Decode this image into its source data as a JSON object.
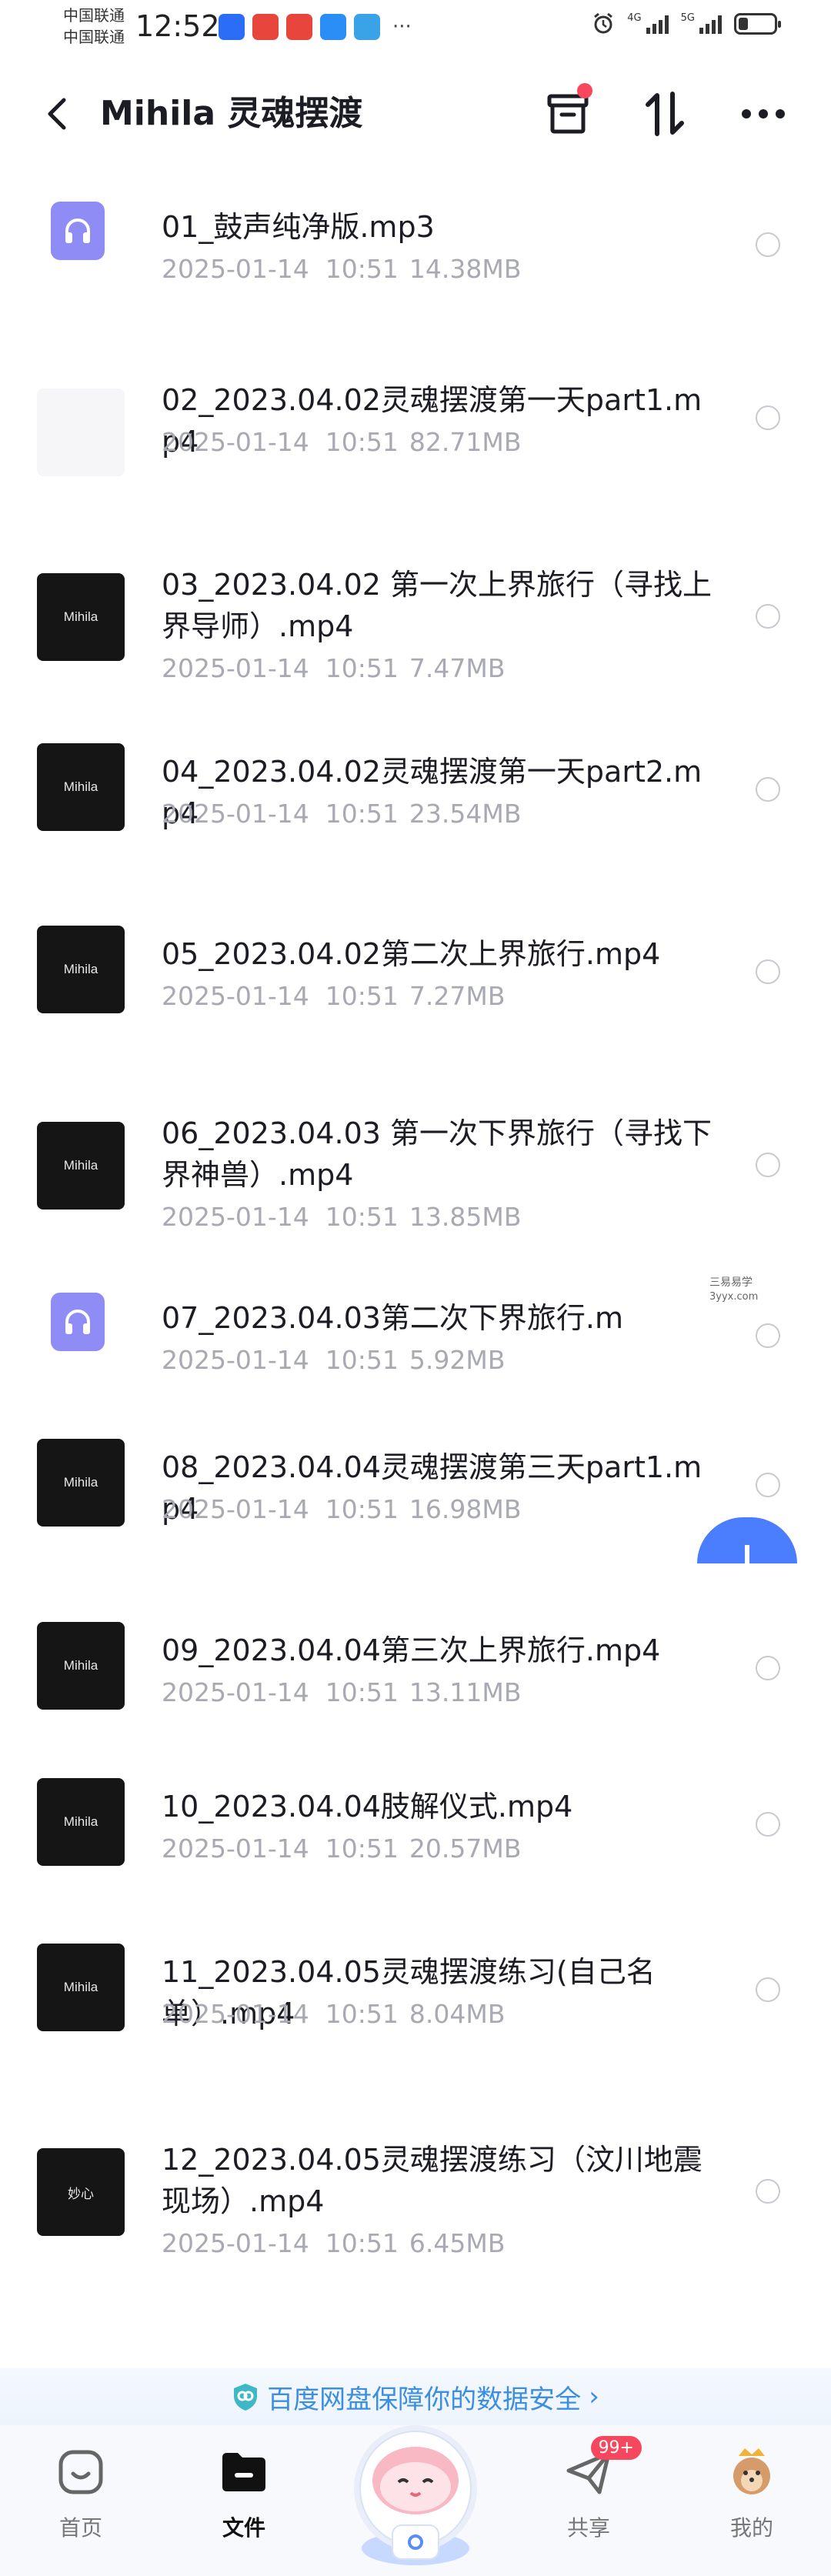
{
  "status_bar": {
    "carrier_1": "中国联通",
    "carrier_2": "中国联通",
    "time": "12:52",
    "net_1": "4G",
    "net_2": "5G",
    "more": "···"
  },
  "header": {
    "title": "Mihila 灵魂摆渡",
    "icons": [
      "back-icon",
      "archive-icon",
      "sort-icon",
      "more-icon"
    ]
  },
  "files": [
    {
      "name": "01_鼓声纯净版.mp3",
      "date": "2025-01-14  10:51",
      "size": "14.38MB",
      "type": "audio"
    },
    {
      "name": "02_2023.04.02灵魂摆渡第一天part1.mp4",
      "date": "2025-01-14  10:51",
      "size": "82.71MB",
      "type": "blank"
    },
    {
      "name": "03_2023.04.02 第一次上界旅行（寻找上界导师）.mp4",
      "date": "2025-01-14  10:51",
      "size": "7.47MB",
      "type": "video",
      "thumb_text": "Mihila"
    },
    {
      "name": "04_2023.04.02灵魂摆渡第一天part2.mp4",
      "date": "2025-01-14  10:51",
      "size": "23.54MB",
      "type": "video",
      "thumb_text": "Mihila"
    },
    {
      "name": "05_2023.04.02第二次上界旅行.mp4",
      "date": "2025-01-14  10:51",
      "size": "7.27MB",
      "type": "video",
      "thumb_text": "Mihila"
    },
    {
      "name": "06_2023.04.03 第一次下界旅行（寻找下界神兽）.mp4",
      "date": "2025-01-14  10:51",
      "size": "13.85MB",
      "type": "video",
      "thumb_text": "Mihila"
    },
    {
      "name": "07_2023.04.03第二次下界旅行.m",
      "date": "2025-01-14  10:51",
      "size": "5.92MB",
      "type": "audio"
    },
    {
      "name": "08_2023.04.04灵魂摆渡第三天part1.mp4",
      "date": "2025-01-14  10:51",
      "size": "16.98MB",
      "type": "video",
      "thumb_text": "Mihila"
    },
    {
      "name": "09_2023.04.04第三次上界旅行.mp4",
      "date": "2025-01-14  10:51",
      "size": "13.11MB",
      "type": "video",
      "thumb_text": "Mihila"
    },
    {
      "name": "10_2023.04.04肢解仪式.mp4",
      "date": "2025-01-14  10:51",
      "size": "20.57MB",
      "type": "video",
      "thumb_text": "Mihila"
    },
    {
      "name": "11_2023.04.05灵魂摆渡练习(自己名单）.mp4",
      "date": "2025-01-14  10:51",
      "size": "8.04MB",
      "type": "video",
      "thumb_text": "Mihila"
    },
    {
      "name": "12_2023.04.05灵魂摆渡练习（汶川地震现场）.mp4",
      "date": "2025-01-14  10:51",
      "size": "6.45MB",
      "type": "video",
      "thumb_text": "妙心"
    }
  ],
  "watermark": {
    "line1": "三易易学",
    "line2": "3yyx.com"
  },
  "safety_banner": {
    "text": "百度网盘保障你的数据安全",
    "chevron": "›"
  },
  "bottom_nav": {
    "items": [
      {
        "label": "首页",
        "icon": "home-icon"
      },
      {
        "label": "文件",
        "icon": "folder-icon",
        "active": true
      },
      {
        "label": "共享",
        "icon": "share-icon",
        "badge": "99+"
      },
      {
        "label": "我的",
        "icon": "profile-icon"
      }
    ]
  },
  "colors": {
    "accent": "#4b7dff",
    "audio_thumb": "#8f8cf5",
    "badge": "#f5475d",
    "meta_text": "#a9a9b3"
  }
}
